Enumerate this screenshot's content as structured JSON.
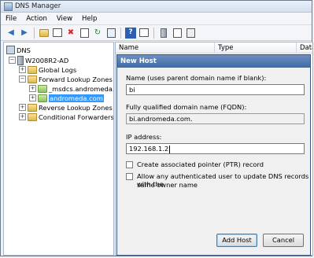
{
  "window": {
    "title": "DNS Manager"
  },
  "menu": [
    "File",
    "Action",
    "View",
    "Help"
  ],
  "toolbar": {
    "icons": [
      "back-icon",
      "forward-icon",
      "up-folder-icon",
      "show-hide-tree-icon",
      "delete-icon",
      "properties-icon",
      "refresh-icon",
      "export-list-icon",
      "help-icon",
      "show-hide-action-pane-icon",
      "server-icon",
      "zone-icon",
      "record-icon"
    ]
  },
  "tree": {
    "items": [
      {
        "label": "DNS",
        "icon": "dns-icon"
      },
      {
        "label": "W2008R2-AD",
        "icon": "server-icon"
      },
      {
        "label": "Global Logs",
        "icon": "folder-icon"
      },
      {
        "label": "Forward Lookup Zones",
        "icon": "folder-icon"
      },
      {
        "label": "_msdcs.andromeda.com",
        "icon": "zone-icon"
      },
      {
        "label": "andromeda.com",
        "icon": "zone-icon",
        "selected": true
      },
      {
        "label": "Reverse Lookup Zones",
        "icon": "folder-icon"
      },
      {
        "label": "Conditional Forwarders",
        "icon": "folder-icon"
      }
    ]
  },
  "list": {
    "columns": [
      "Name",
      "Type",
      "Data"
    ]
  },
  "dialog": {
    "title": "New Host",
    "name_label": "Name (uses parent domain name if blank):",
    "name_value": "bi",
    "fqdn_label": "Fully qualified domain name (FQDN):",
    "fqdn_value": "bi.andromeda.com.",
    "ip_label": "IP address:",
    "ip_value": "192.168.1.2",
    "ptr_label": "Create associated pointer (PTR) record",
    "auth_label_line1": "Allow any authenticated user to update DNS records with the",
    "auth_label_line2": "same owner name",
    "add_button": "Add Host",
    "cancel_button": "Cancel"
  }
}
